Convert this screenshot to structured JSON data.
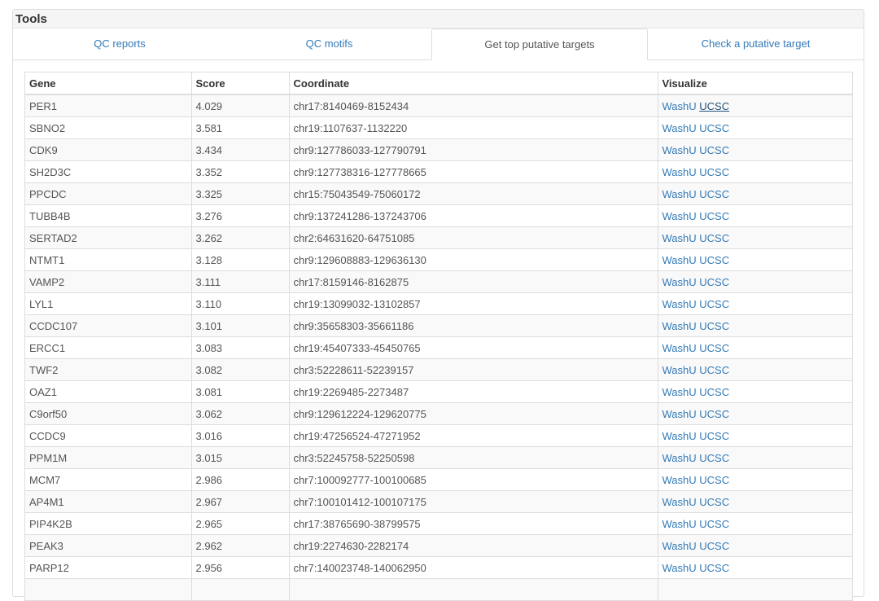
{
  "panel": {
    "title": "Tools"
  },
  "tabs": [
    {
      "label": "QC reports",
      "active": false
    },
    {
      "label": "QC motifs",
      "active": false
    },
    {
      "label": "Get top putative targets",
      "active": true
    },
    {
      "label": "Check a putative target",
      "active": false
    }
  ],
  "table": {
    "headers": [
      "Gene",
      "Score",
      "Coordinate",
      "Visualize"
    ],
    "link_labels": [
      "WashU",
      "UCSC"
    ],
    "rows": [
      [
        "PER1",
        "4.029",
        "chr17:8140469-8152434"
      ],
      [
        "SBNO2",
        "3.581",
        "chr19:1107637-1132220"
      ],
      [
        "CDK9",
        "3.434",
        "chr9:127786033-127790791"
      ],
      [
        "SH2D3C",
        "3.352",
        "chr9:127738316-127778665"
      ],
      [
        "PPCDC",
        "3.325",
        "chr15:75043549-75060172"
      ],
      [
        "TUBB4B",
        "3.276",
        "chr9:137241286-137243706"
      ],
      [
        "SERTAD2",
        "3.262",
        "chr2:64631620-64751085"
      ],
      [
        "NTMT1",
        "3.128",
        "chr9:129608883-129636130"
      ],
      [
        "VAMP2",
        "3.111",
        "chr17:8159146-8162875"
      ],
      [
        "LYL1",
        "3.110",
        "chr19:13099032-13102857"
      ],
      [
        "CCDC107",
        "3.101",
        "chr9:35658303-35661186"
      ],
      [
        "ERCC1",
        "3.083",
        "chr19:45407333-45450765"
      ],
      [
        "TWF2",
        "3.082",
        "chr3:52228611-52239157"
      ],
      [
        "OAZ1",
        "3.081",
        "chr19:2269485-2273487"
      ],
      [
        "C9orf50",
        "3.062",
        "chr9:129612224-129620775"
      ],
      [
        "CCDC9",
        "3.016",
        "chr19:47256524-47271952"
      ],
      [
        "PPM1M",
        "3.015",
        "chr3:52245758-52250598"
      ],
      [
        "MCM7",
        "2.986",
        "chr7:100092777-100100685"
      ],
      [
        "AP4M1",
        "2.967",
        "chr7:100101412-100107175"
      ],
      [
        "PIP4K2B",
        "2.965",
        "chr17:38765690-38799575"
      ],
      [
        "PEAK3",
        "2.962",
        "chr19:2274630-2282174"
      ],
      [
        "PARP12",
        "2.956",
        "chr7:140023748-140062950"
      ],
      [
        "",
        "",
        ""
      ]
    ]
  }
}
